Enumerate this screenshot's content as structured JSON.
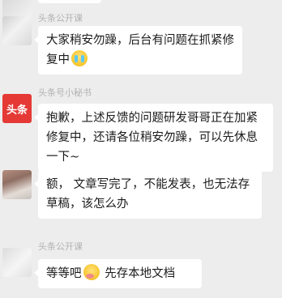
{
  "messages": [
    {
      "sender": "头条公开课",
      "text": "大家稍安勿躁，后台有问题在抓紧修复中",
      "emoji": "crying-face-emoji"
    },
    {
      "sender": "头条号小秘书",
      "avatar_logo": "头条",
      "text": "抱歉，上述反馈的问题研发哥哥正在加紧修复中，还请各位稍安勿躁，可以先休息一下~"
    },
    {
      "sender": "",
      "text": "额， 文章写完了，不能发表，也无法存草稿，该怎么办"
    },
    {
      "sender": "头条公开课",
      "text_before": "等等吧",
      "text_after": " 先存本地文档",
      "emoji": "face-emoji"
    }
  ],
  "colors": {
    "background": "#ededed",
    "bubble": "#ffffff",
    "sender_name": "#b2b2b2",
    "logo_red": "#e53935"
  }
}
